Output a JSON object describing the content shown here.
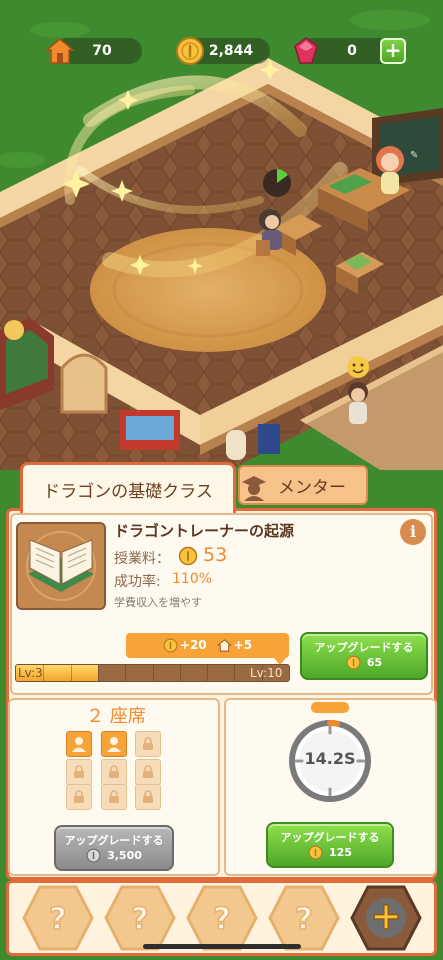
{
  "resources": {
    "houses": "70",
    "coins": "2,844",
    "gems": "0",
    "plus_label": "+"
  },
  "tabs": [
    {
      "label": "ドラゴンの基礎クラス",
      "active": true
    },
    {
      "label": "メンター",
      "active": false
    }
  ],
  "course": {
    "title": "ドラゴントレーナーの起源",
    "info_label": "i",
    "fee_label": "授業料：",
    "fee_value": "53",
    "success_label": "成功率:",
    "success_value": "110%",
    "description": "学費収入を増やす",
    "bonus_coins": "+20",
    "bonus_houses": "+5",
    "level_current": "Lv:3",
    "level_max": "Lv:10",
    "level_progress": 0.3,
    "upgrade_label": "アップグレードする",
    "upgrade_cost": "65"
  },
  "seats": {
    "title": "２ 座席",
    "open": 2,
    "total": 9,
    "upgrade_label": "アップグレードする",
    "upgrade_cost": "3,500"
  },
  "timer": {
    "value": "14.2S",
    "progress": 0.03,
    "upgrade_label": "アップグレードする",
    "upgrade_cost": "125"
  },
  "dock": {
    "slots": [
      {
        "icon": "question-icon",
        "locked": true,
        "label": "?"
      },
      {
        "icon": "question-icon",
        "locked": true,
        "label": "?"
      },
      {
        "icon": "question-icon",
        "locked": true,
        "label": "?"
      },
      {
        "icon": "question-icon",
        "locked": true,
        "label": "?"
      },
      {
        "icon": "add-icon",
        "locked": false,
        "label": "+"
      }
    ]
  },
  "colors": {
    "accent_orange": "#f08a2c",
    "panel_border": "#e06a3a",
    "button_green": "#4ea829",
    "button_gray": "#8b8b8b",
    "grass": "#3f8a2e"
  }
}
